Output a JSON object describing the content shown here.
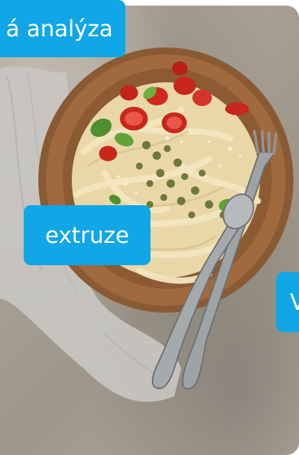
{
  "tags": {
    "top_label": "á analýza",
    "middle_label": "extruze",
    "right_label": "V"
  },
  "colors": {
    "tag_background": "#11a6e6",
    "tag_text": "#ffffff"
  },
  "image": {
    "icon": "pasta-bowl-photo"
  }
}
